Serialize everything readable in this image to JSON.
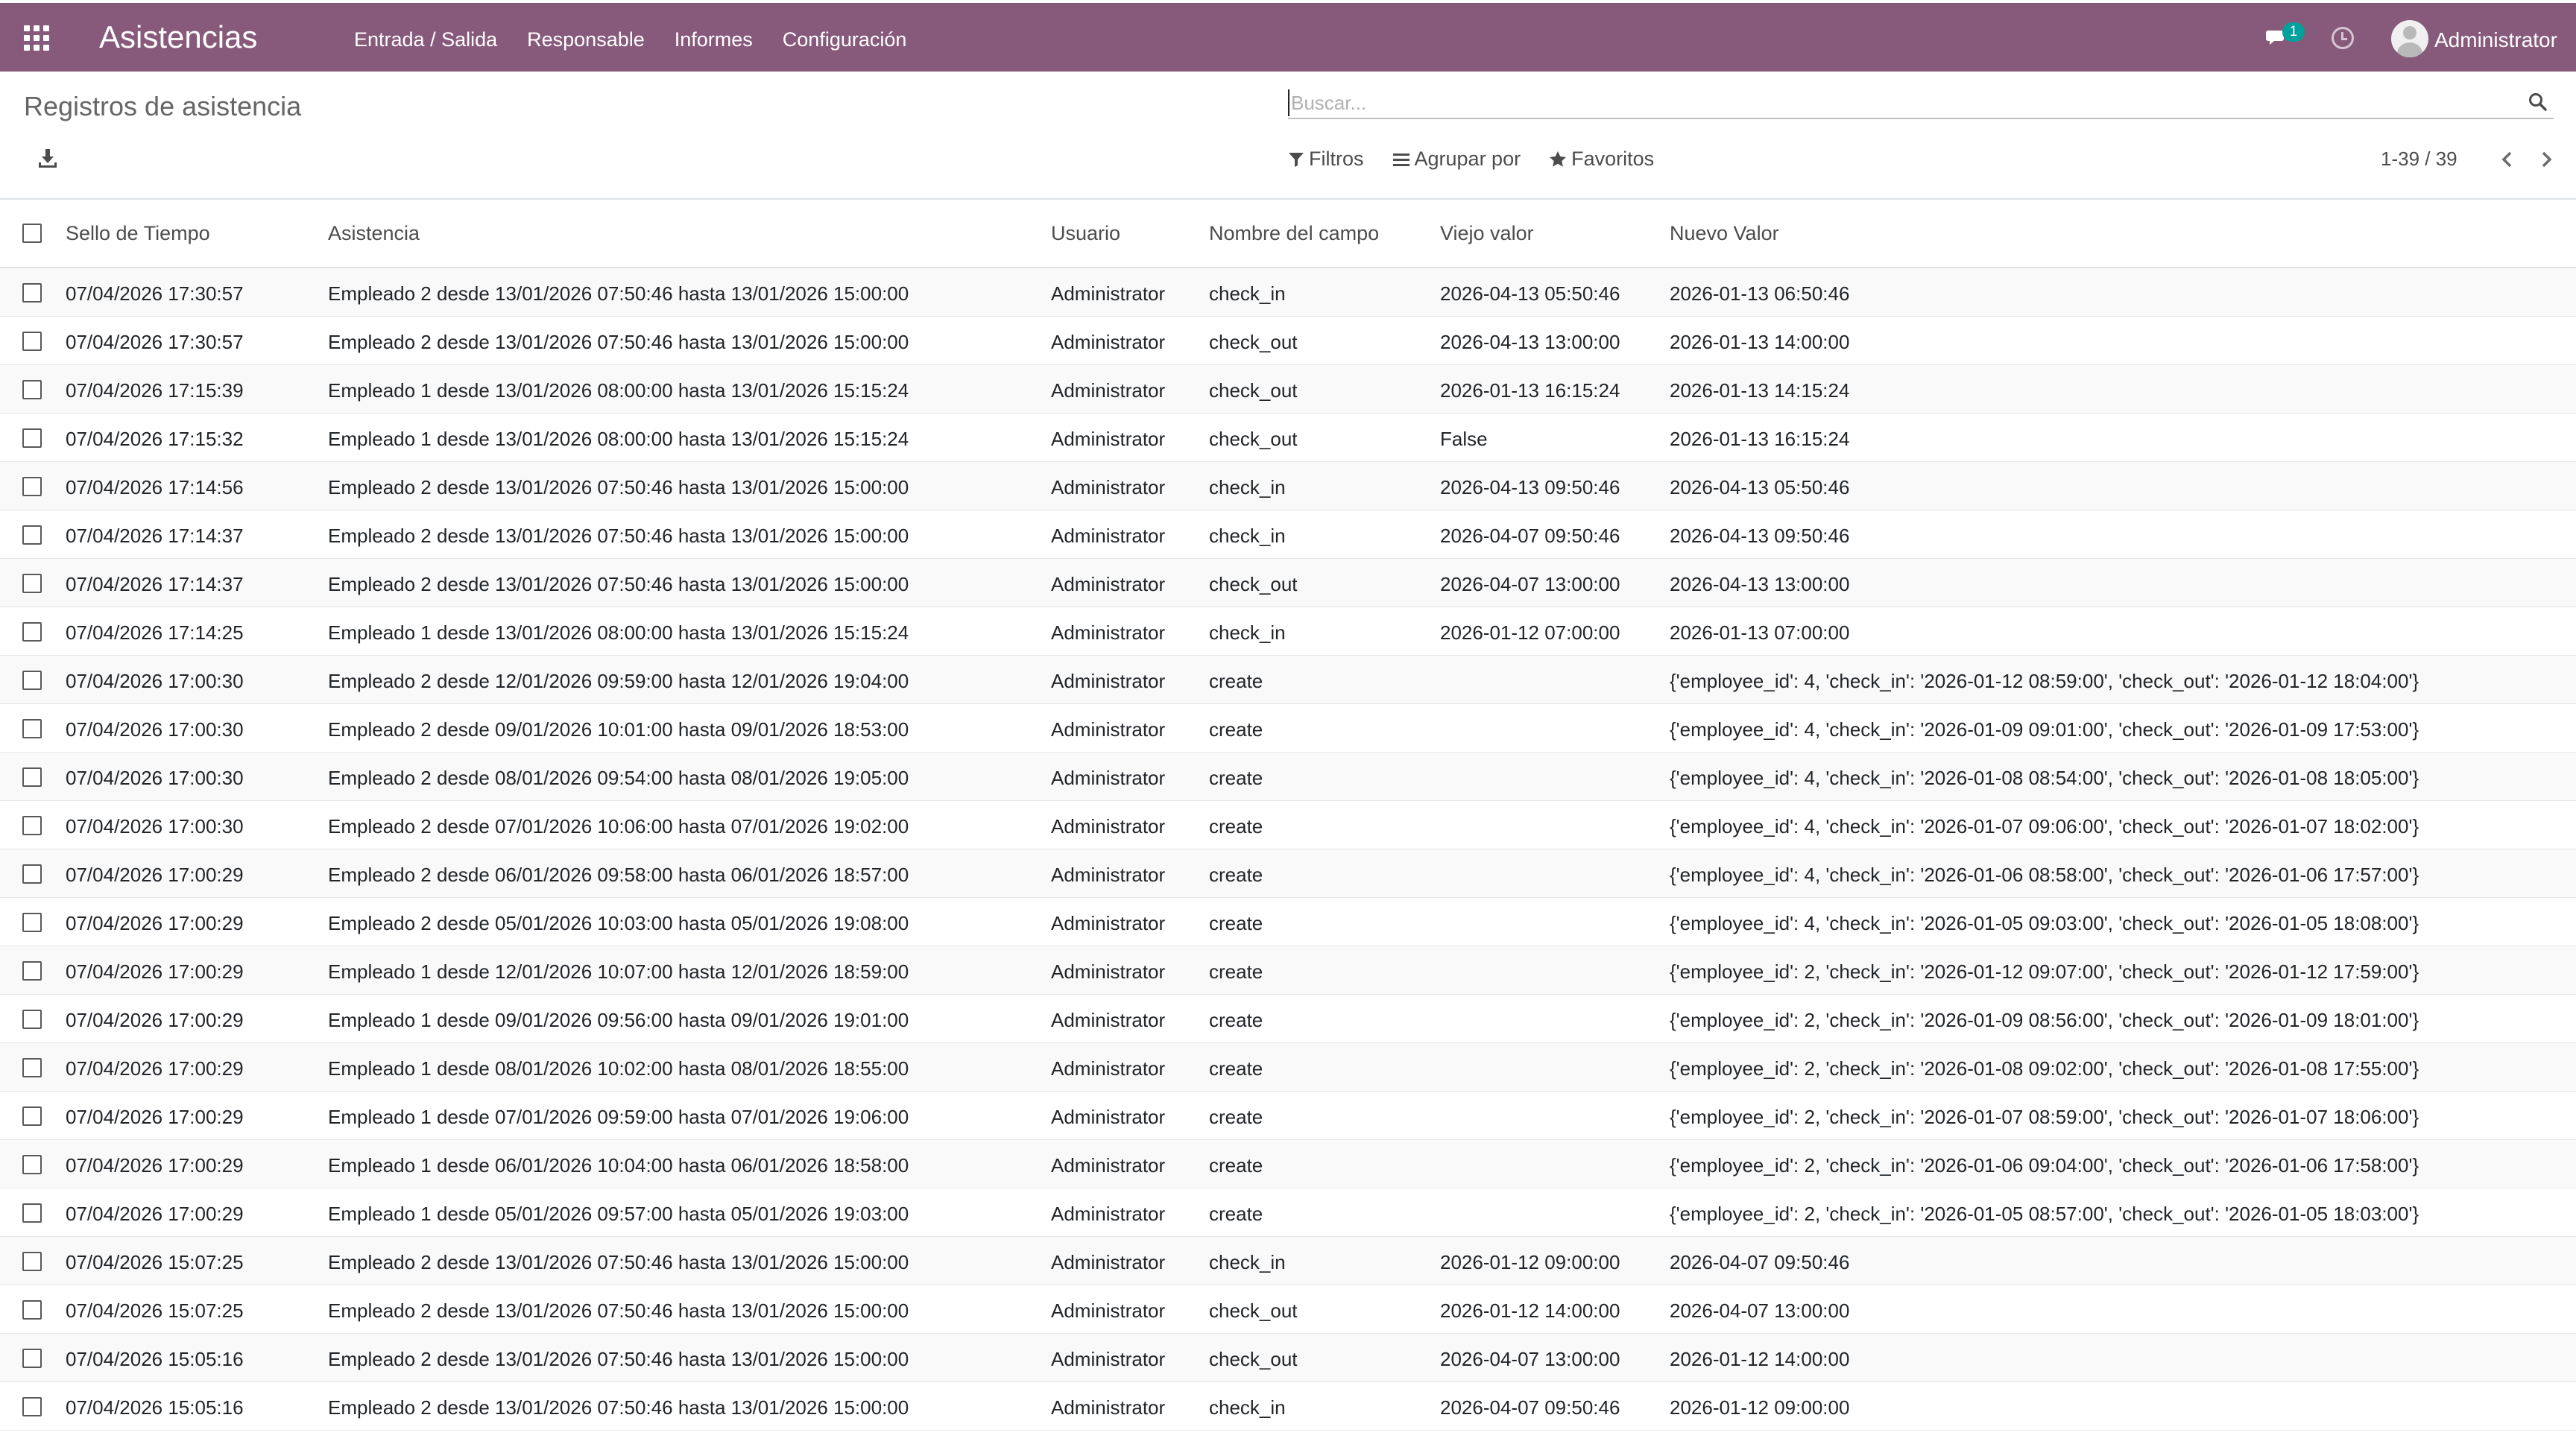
{
  "navbar": {
    "app_title": "Asistencias",
    "menu": [
      "Entrada / Salida",
      "Responsable",
      "Informes",
      "Configuración"
    ],
    "chat_badge": "1",
    "user": "Administrator",
    "bg_color": "#875a7b"
  },
  "control_panel": {
    "breadcrumb": "Registros de asistencia",
    "search_placeholder": "Buscar...",
    "filters_label": "Filtros",
    "group_by_label": "Agrupar por",
    "favorites_label": "Favoritos",
    "pager": "1-39 / 39"
  },
  "table": {
    "columns": [
      "Sello de Tiempo",
      "Asistencia",
      "Usuario",
      "Nombre del campo",
      "Viejo valor",
      "Nuevo Valor"
    ],
    "rows": [
      [
        "07/04/2026 17:30:57",
        "Empleado 2 desde 13/01/2026 07:50:46 hasta 13/01/2026 15:00:00",
        "Administrator",
        "check_in",
        "2026-04-13 05:50:46",
        "2026-01-13 06:50:46"
      ],
      [
        "07/04/2026 17:30:57",
        "Empleado 2 desde 13/01/2026 07:50:46 hasta 13/01/2026 15:00:00",
        "Administrator",
        "check_out",
        "2026-04-13 13:00:00",
        "2026-01-13 14:00:00"
      ],
      [
        "07/04/2026 17:15:39",
        "Empleado 1 desde 13/01/2026 08:00:00 hasta 13/01/2026 15:15:24",
        "Administrator",
        "check_out",
        "2026-01-13 16:15:24",
        "2026-01-13 14:15:24"
      ],
      [
        "07/04/2026 17:15:32",
        "Empleado 1 desde 13/01/2026 08:00:00 hasta 13/01/2026 15:15:24",
        "Administrator",
        "check_out",
        "False",
        "2026-01-13 16:15:24"
      ],
      [
        "07/04/2026 17:14:56",
        "Empleado 2 desde 13/01/2026 07:50:46 hasta 13/01/2026 15:00:00",
        "Administrator",
        "check_in",
        "2026-04-13 09:50:46",
        "2026-04-13 05:50:46"
      ],
      [
        "07/04/2026 17:14:37",
        "Empleado 2 desde 13/01/2026 07:50:46 hasta 13/01/2026 15:00:00",
        "Administrator",
        "check_in",
        "2026-04-07 09:50:46",
        "2026-04-13 09:50:46"
      ],
      [
        "07/04/2026 17:14:37",
        "Empleado 2 desde 13/01/2026 07:50:46 hasta 13/01/2026 15:00:00",
        "Administrator",
        "check_out",
        "2026-04-07 13:00:00",
        "2026-04-13 13:00:00"
      ],
      [
        "07/04/2026 17:14:25",
        "Empleado 1 desde 13/01/2026 08:00:00 hasta 13/01/2026 15:15:24",
        "Administrator",
        "check_in",
        "2026-01-12 07:00:00",
        "2026-01-13 07:00:00"
      ],
      [
        "07/04/2026 17:00:30",
        "Empleado 2 desde 12/01/2026 09:59:00 hasta 12/01/2026 19:04:00",
        "Administrator",
        "create",
        "",
        "{'employee_id': 4, 'check_in': '2026-01-12 08:59:00', 'check_out': '2026-01-12 18:04:00'}"
      ],
      [
        "07/04/2026 17:00:30",
        "Empleado 2 desde 09/01/2026 10:01:00 hasta 09/01/2026 18:53:00",
        "Administrator",
        "create",
        "",
        "{'employee_id': 4, 'check_in': '2026-01-09 09:01:00', 'check_out': '2026-01-09 17:53:00'}"
      ],
      [
        "07/04/2026 17:00:30",
        "Empleado 2 desde 08/01/2026 09:54:00 hasta 08/01/2026 19:05:00",
        "Administrator",
        "create",
        "",
        "{'employee_id': 4, 'check_in': '2026-01-08 08:54:00', 'check_out': '2026-01-08 18:05:00'}"
      ],
      [
        "07/04/2026 17:00:30",
        "Empleado 2 desde 07/01/2026 10:06:00 hasta 07/01/2026 19:02:00",
        "Administrator",
        "create",
        "",
        "{'employee_id': 4, 'check_in': '2026-01-07 09:06:00', 'check_out': '2026-01-07 18:02:00'}"
      ],
      [
        "07/04/2026 17:00:29",
        "Empleado 2 desde 06/01/2026 09:58:00 hasta 06/01/2026 18:57:00",
        "Administrator",
        "create",
        "",
        "{'employee_id': 4, 'check_in': '2026-01-06 08:58:00', 'check_out': '2026-01-06 17:57:00'}"
      ],
      [
        "07/04/2026 17:00:29",
        "Empleado 2 desde 05/01/2026 10:03:00 hasta 05/01/2026 19:08:00",
        "Administrator",
        "create",
        "",
        "{'employee_id': 4, 'check_in': '2026-01-05 09:03:00', 'check_out': '2026-01-05 18:08:00'}"
      ],
      [
        "07/04/2026 17:00:29",
        "Empleado 1 desde 12/01/2026 10:07:00 hasta 12/01/2026 18:59:00",
        "Administrator",
        "create",
        "",
        "{'employee_id': 2, 'check_in': '2026-01-12 09:07:00', 'check_out': '2026-01-12 17:59:00'}"
      ],
      [
        "07/04/2026 17:00:29",
        "Empleado 1 desde 09/01/2026 09:56:00 hasta 09/01/2026 19:01:00",
        "Administrator",
        "create",
        "",
        "{'employee_id': 2, 'check_in': '2026-01-09 08:56:00', 'check_out': '2026-01-09 18:01:00'}"
      ],
      [
        "07/04/2026 17:00:29",
        "Empleado 1 desde 08/01/2026 10:02:00 hasta 08/01/2026 18:55:00",
        "Administrator",
        "create",
        "",
        "{'employee_id': 2, 'check_in': '2026-01-08 09:02:00', 'check_out': '2026-01-08 17:55:00'}"
      ],
      [
        "07/04/2026 17:00:29",
        "Empleado 1 desde 07/01/2026 09:59:00 hasta 07/01/2026 19:06:00",
        "Administrator",
        "create",
        "",
        "{'employee_id': 2, 'check_in': '2026-01-07 08:59:00', 'check_out': '2026-01-07 18:06:00'}"
      ],
      [
        "07/04/2026 17:00:29",
        "Empleado 1 desde 06/01/2026 10:04:00 hasta 06/01/2026 18:58:00",
        "Administrator",
        "create",
        "",
        "{'employee_id': 2, 'check_in': '2026-01-06 09:04:00', 'check_out': '2026-01-06 17:58:00'}"
      ],
      [
        "07/04/2026 17:00:29",
        "Empleado 1 desde 05/01/2026 09:57:00 hasta 05/01/2026 19:03:00",
        "Administrator",
        "create",
        "",
        "{'employee_id': 2, 'check_in': '2026-01-05 08:57:00', 'check_out': '2026-01-05 18:03:00'}"
      ],
      [
        "07/04/2026 15:07:25",
        "Empleado 2 desde 13/01/2026 07:50:46 hasta 13/01/2026 15:00:00",
        "Administrator",
        "check_in",
        "2026-01-12 09:00:00",
        "2026-04-07 09:50:46"
      ],
      [
        "07/04/2026 15:07:25",
        "Empleado 2 desde 13/01/2026 07:50:46 hasta 13/01/2026 15:00:00",
        "Administrator",
        "check_out",
        "2026-01-12 14:00:00",
        "2026-04-07 13:00:00"
      ],
      [
        "07/04/2026 15:05:16",
        "Empleado 2 desde 13/01/2026 07:50:46 hasta 13/01/2026 15:00:00",
        "Administrator",
        "check_out",
        "2026-04-07 13:00:00",
        "2026-01-12 14:00:00"
      ],
      [
        "07/04/2026 15:05:16",
        "Empleado 2 desde 13/01/2026 07:50:46 hasta 13/01/2026 15:00:00",
        "Administrator",
        "check_in",
        "2026-04-07 09:50:46",
        "2026-01-12 09:00:00"
      ]
    ]
  }
}
